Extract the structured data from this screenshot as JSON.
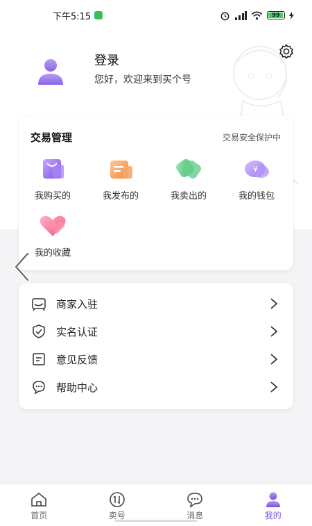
{
  "status": {
    "time": "下午5:15",
    "battery": "99"
  },
  "profile": {
    "login_title": "登录",
    "welcome": "您好，欢迎来到买个号"
  },
  "trade": {
    "title": "交易管理",
    "secure_text": "交易安全保护中",
    "items": [
      {
        "label": "我购买的",
        "icon": "bag-icon"
      },
      {
        "label": "我发布的",
        "icon": "publish-icon"
      },
      {
        "label": "我卖出的",
        "icon": "sold-icon"
      },
      {
        "label": "我的钱包",
        "icon": "wallet-icon"
      },
      {
        "label": "我的收藏",
        "icon": "heart-icon"
      }
    ]
  },
  "menu": [
    {
      "label": "商家入驻",
      "icon": "store-icon"
    },
    {
      "label": "实名认证",
      "icon": "shield-check-icon"
    },
    {
      "label": "意见反馈",
      "icon": "edit-icon"
    },
    {
      "label": "帮助中心",
      "icon": "help-chat-icon"
    }
  ],
  "nav": [
    {
      "label": "首页",
      "icon": "home-icon",
      "active": false
    },
    {
      "label": "卖号",
      "icon": "sell-icon",
      "active": false
    },
    {
      "label": "消息",
      "icon": "message-icon",
      "active": false
    },
    {
      "label": "我的",
      "icon": "user-icon",
      "active": true
    }
  ],
  "colors": {
    "accent": "#7b4fe0",
    "background": "#f4f4f6"
  }
}
